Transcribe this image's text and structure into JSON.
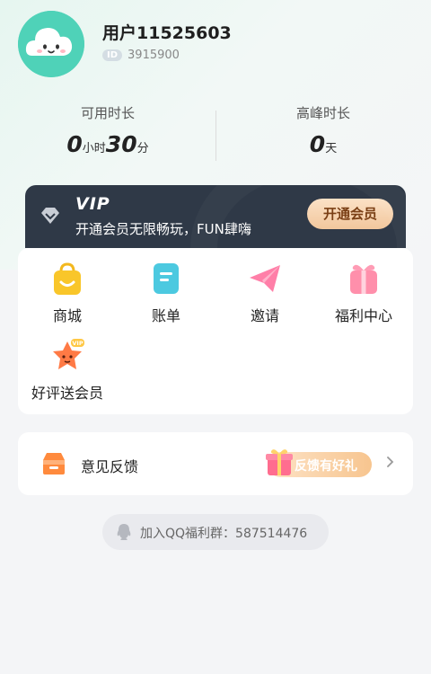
{
  "profile": {
    "username": "用户11525603",
    "id_label": "ID",
    "id_value": "3915900"
  },
  "stats": {
    "available": {
      "label": "可用时长",
      "hours": "0",
      "hours_unit": "小时",
      "minutes": "30",
      "minutes_unit": "分"
    },
    "peak": {
      "label": "高峰时长",
      "days": "0",
      "days_unit": "天"
    }
  },
  "vip": {
    "title": "VIP",
    "description": "开通会员无限畅玩，FUN肆嗨",
    "button_label": "开通会员"
  },
  "menu": {
    "items": [
      {
        "label": "商城",
        "icon": "shopping-bag-icon"
      },
      {
        "label": "账单",
        "icon": "bill-icon"
      },
      {
        "label": "邀请",
        "icon": "paper-plane-icon"
      },
      {
        "label": "福利中心",
        "icon": "gift-box-icon"
      },
      {
        "label": "好评送会员",
        "icon": "star-vip-icon"
      }
    ]
  },
  "feedback": {
    "label": "意见反馈",
    "badge": "反馈有好礼",
    "icon": "mailbox-icon"
  },
  "qq_group": {
    "text": "加入QQ福利群：587514476",
    "icon": "qq-icon"
  },
  "colors": {
    "accent_green": "#4fd2b8",
    "vip_card": "#2f3947",
    "vip_button": "#f2c79d",
    "background": "#f4f5f7"
  }
}
